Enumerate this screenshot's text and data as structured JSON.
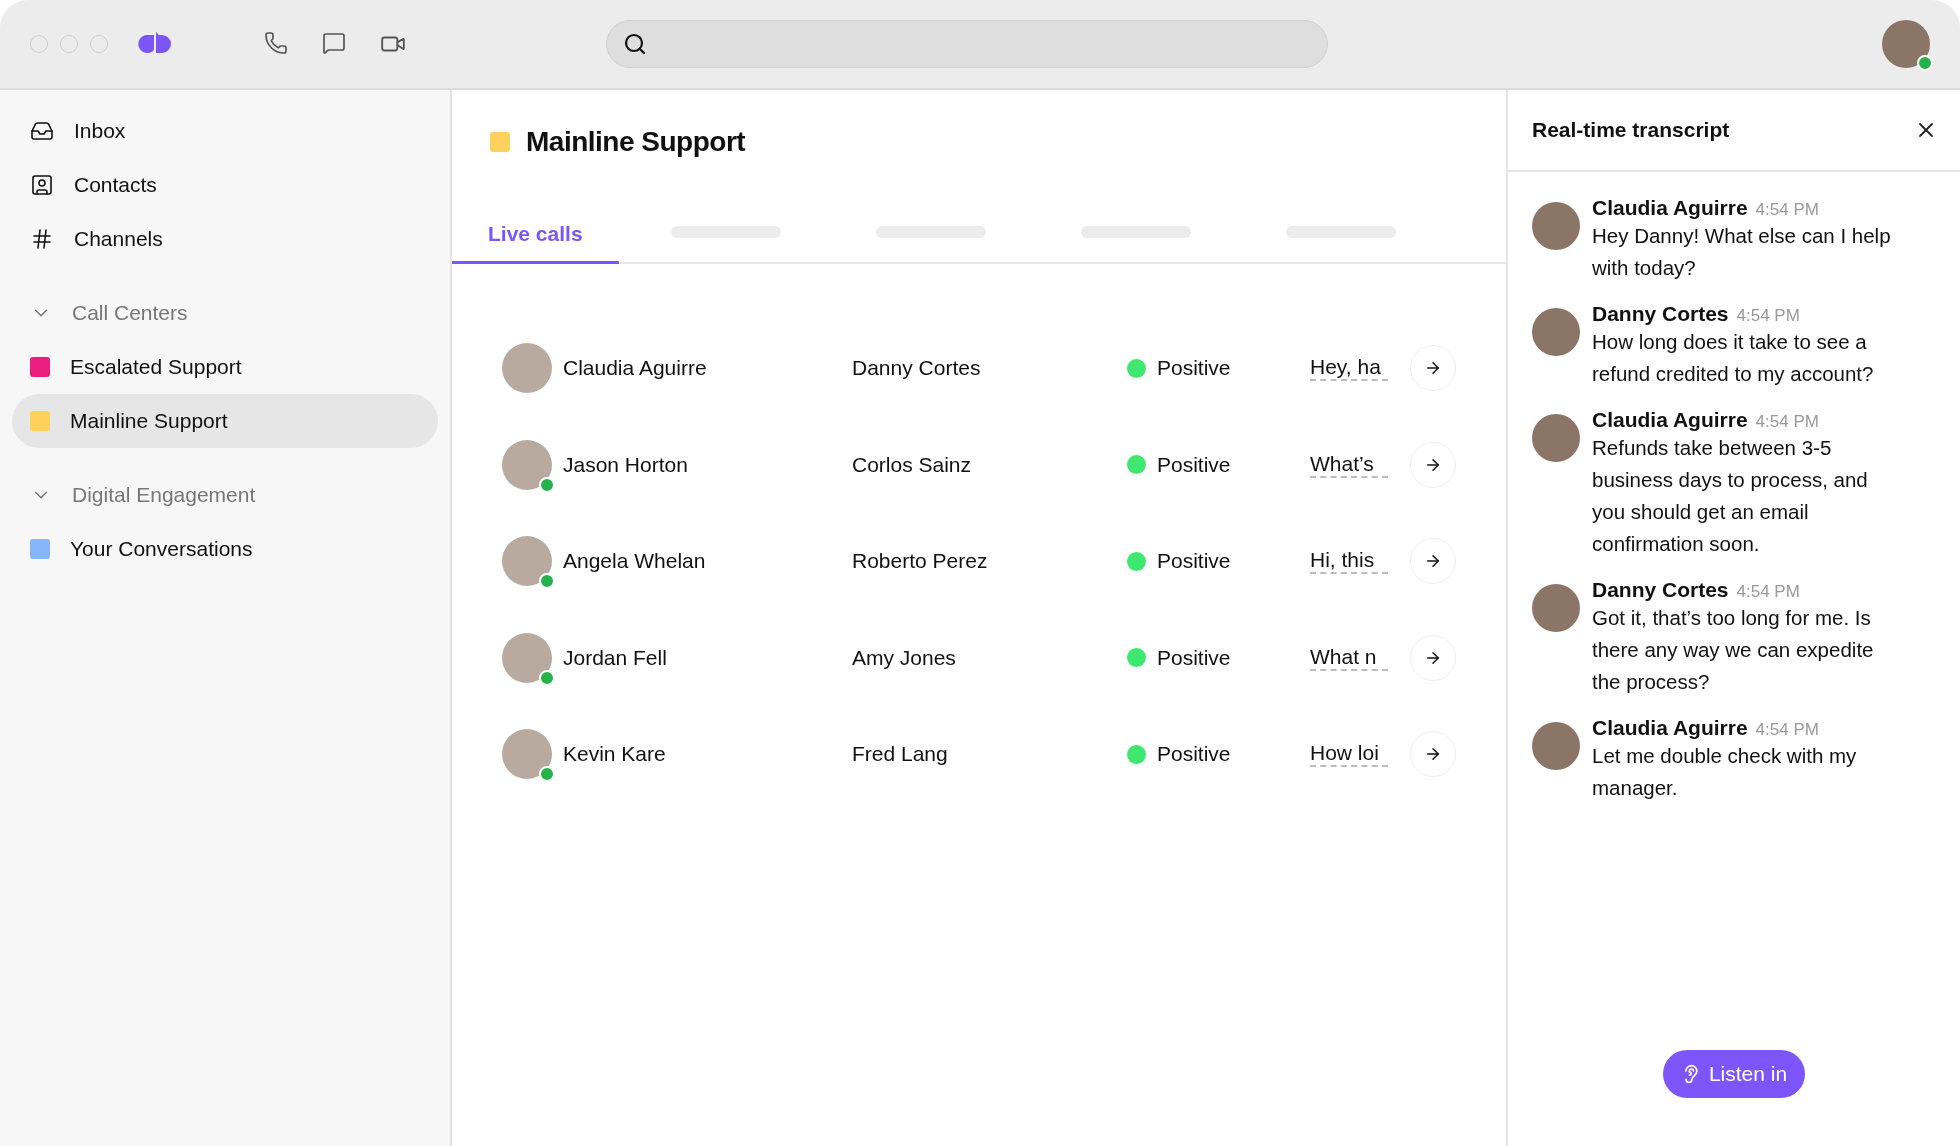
{
  "toolbar": {
    "user": {
      "online": true
    }
  },
  "sidebar": {
    "items": [
      {
        "label": "Inbox",
        "kind": "inbox"
      },
      {
        "label": "Contacts",
        "kind": "contacts"
      },
      {
        "label": "Channels",
        "kind": "channels"
      }
    ],
    "groups": [
      {
        "label": "Call Centers",
        "expanded": true,
        "items": [
          {
            "label": "Escalated Support",
            "color": "#eb1d7f",
            "selected": false
          },
          {
            "label": "Mainline Support",
            "color": "#fdd15b",
            "selected": true
          }
        ]
      },
      {
        "label": "Digital Engagement",
        "expanded": true,
        "items": [
          {
            "label": "Your Conversations",
            "color": "#84b8fb",
            "selected": false
          }
        ]
      }
    ]
  },
  "main": {
    "title": "Mainline Support",
    "color": "#fdd15b",
    "tabs": [
      {
        "label": "Live calls",
        "kind": "text",
        "selected": true
      },
      {
        "kind": "placeholder",
        "selected": false
      },
      {
        "kind": "placeholder",
        "selected": false
      },
      {
        "kind": "placeholder",
        "selected": false
      },
      {
        "kind": "placeholder",
        "selected": false
      }
    ],
    "rows": [
      {
        "agent": "Claudia Aguirre",
        "online": false,
        "caller": "Danny Cortes",
        "sentiment": "Positive",
        "color": "#3ee870",
        "preview": "Hey, ha"
      },
      {
        "agent": "Jason Horton",
        "online": true,
        "caller": "Corlos Sainz",
        "sentiment": "Positive",
        "color": "#3ee870",
        "preview": "What’s"
      },
      {
        "agent": "Angela Whelan",
        "online": true,
        "caller": "Roberto Perez",
        "sentiment": "Positive",
        "color": "#3ee870",
        "preview": "Hi, this"
      },
      {
        "agent": "Jordan Fell",
        "online": true,
        "caller": "Amy Jones",
        "sentiment": "Positive",
        "color": "#3ee870",
        "preview": "What n"
      },
      {
        "agent": "Kevin Kare",
        "online": true,
        "caller": "Fred Lang",
        "sentiment": "Positive",
        "color": "#3ee870",
        "preview": "How loi"
      }
    ]
  },
  "transcript": {
    "title": "Real-time transcript",
    "messages": [
      {
        "name": "Claudia Aguirre",
        "time": "4:54 PM",
        "text": "Hey Danny! What else can I help with today?"
      },
      {
        "name": "Danny Cortes",
        "time": "4:54 PM",
        "text": "How long does it take to see a refund credited to my account?"
      },
      {
        "name": "Claudia Aguirre",
        "time": "4:54 PM",
        "text": "Refunds take between 3-5 business days to process, and you should get an email confirmation soon."
      },
      {
        "name": "Danny Cortes",
        "time": "4:54 PM",
        "text": "Got it, that’s too long for me. Is there any way we can expedite the process?"
      },
      {
        "name": "Claudia Aguirre",
        "time": "4:54 PM",
        "text": "Let me double check with my manager."
      }
    ],
    "button": "Listen in"
  }
}
